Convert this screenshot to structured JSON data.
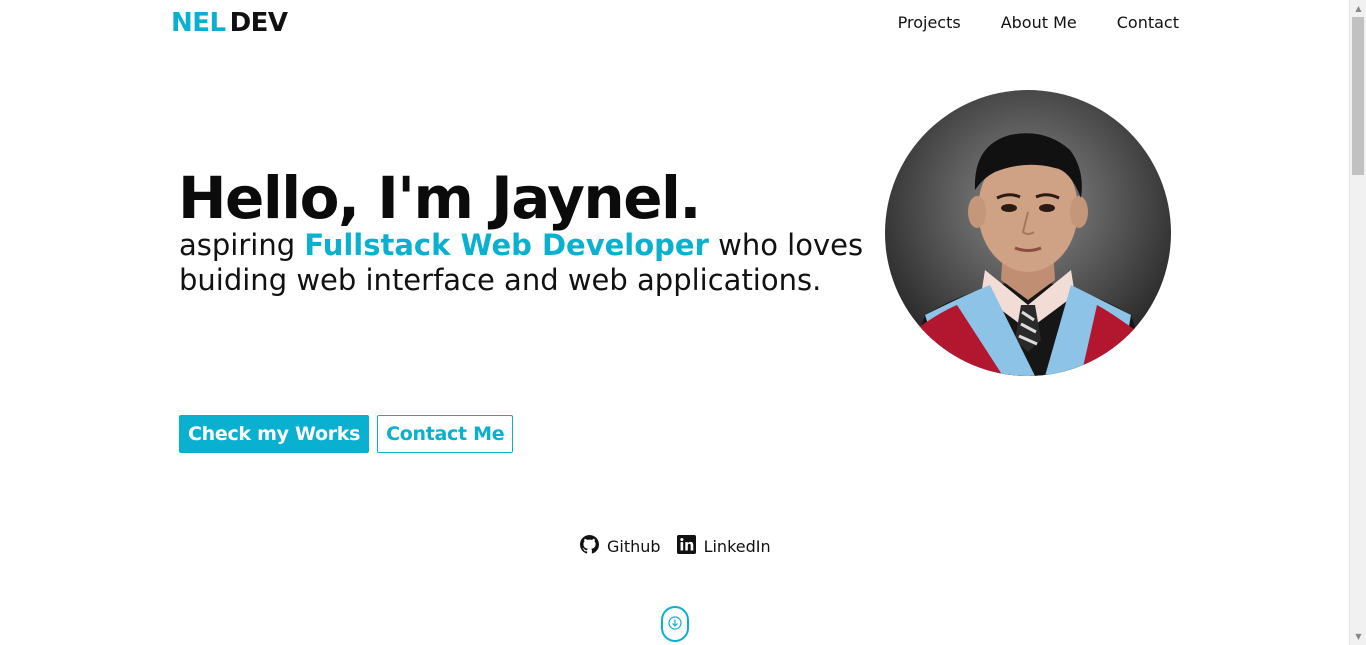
{
  "header": {
    "logo_part1": "NEL",
    "logo_part2": "DEV",
    "nav": [
      "Projects",
      "About Me",
      "Contact"
    ]
  },
  "hero": {
    "title": "Hello, I'm Jaynel.",
    "sub_prefix": "aspiring ",
    "sub_highlight": "Fullstack Web Developer",
    "sub_suffix": " who loves buiding web interface and web applications."
  },
  "buttons": {
    "primary": "Check my Works",
    "secondary": "Contact Me"
  },
  "social": {
    "github": "Github",
    "linkedin": "LinkedIn"
  },
  "colors": {
    "accent": "#0ab0d0",
    "text": "#111111"
  }
}
